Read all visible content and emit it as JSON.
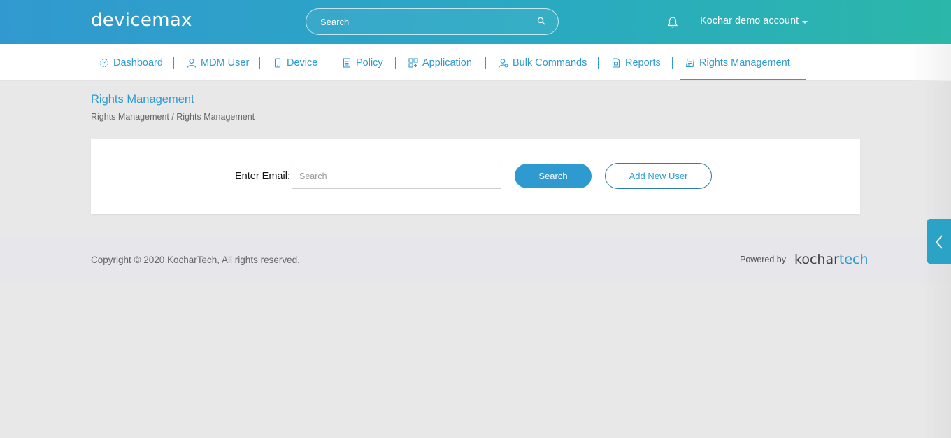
{
  "header": {
    "logo": "devicemax",
    "search_placeholder": "Search",
    "account_name": "Kochar demo account",
    "icons": {
      "search": "search-icon",
      "notifications": "bell-icon",
      "menu": "caret-down-icon"
    }
  },
  "nav": {
    "items": [
      {
        "label": "Dashboard",
        "icon": "dashboard-icon"
      },
      {
        "label": "MDM User",
        "icon": "user-icon"
      },
      {
        "label": "Device",
        "icon": "phone-icon"
      },
      {
        "label": "Policy",
        "icon": "document-icon"
      },
      {
        "label": "Application",
        "icon": "apps-grid-icon"
      },
      {
        "label": "Bulk Commands",
        "icon": "user-settings-icon"
      },
      {
        "label": "Reports",
        "icon": "report-icon"
      },
      {
        "label": "Rights Management",
        "icon": "rights-icon"
      }
    ],
    "active": "Rights Management"
  },
  "page": {
    "title": "Rights Management",
    "breadcrumb": "Rights Management / Rights Management"
  },
  "form": {
    "email_label": "Enter Email:",
    "email_placeholder": "Search",
    "search_button": "Search",
    "add_button": "Add New User"
  },
  "footer": {
    "copyright": "Copyright © 2020 KocharTech, All rights reserved.",
    "powered_by": "Powered by",
    "brand_part1": "kochar",
    "brand_part2": "tech"
  },
  "colors": {
    "accent": "#2e9ad0",
    "header_start": "#3199cf",
    "header_end": "#2bb7a9"
  }
}
